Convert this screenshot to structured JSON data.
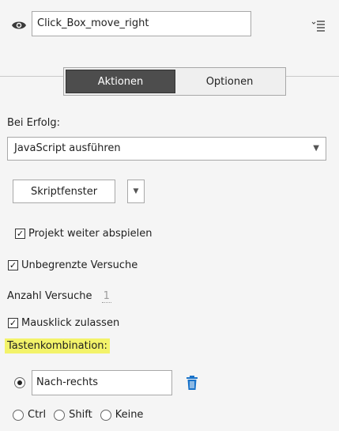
{
  "object": {
    "name_value": "Click_Box_move_right"
  },
  "tabs": [
    {
      "label": "Aktionen",
      "active": true
    },
    {
      "label": "Optionen",
      "active": false
    }
  ],
  "on_success": {
    "label": "Bei Erfolg:",
    "selected_action": "JavaScript ausführen"
  },
  "script_window_button": "Skriptfenster",
  "checkboxes": {
    "continue_project": {
      "label": "Projekt weiter abspielen",
      "checked": true
    },
    "unlimited_attempts": {
      "label": "Unbegrenzte Versuche",
      "checked": true
    },
    "allow_mouse_click": {
      "label": "Mausklick zulassen",
      "checked": true
    }
  },
  "attempts": {
    "label": "Anzahl Versuche",
    "value": "1"
  },
  "shortcut": {
    "label": "Tastenkombination:",
    "value": "Nach-rechts",
    "highlight_color": "#f3f36a",
    "modifiers": [
      {
        "label": "Ctrl",
        "selected": false
      },
      {
        "label": "Shift",
        "selected": false
      },
      {
        "label": "Keine",
        "selected": false
      }
    ]
  },
  "icons": {
    "visibility": "eye-icon",
    "panel_menu": "panel-menu-icon",
    "delete": "trash-icon"
  },
  "colors": {
    "active_tab_bg": "#4d4d4d",
    "trash_icon": "#1a73c9"
  }
}
